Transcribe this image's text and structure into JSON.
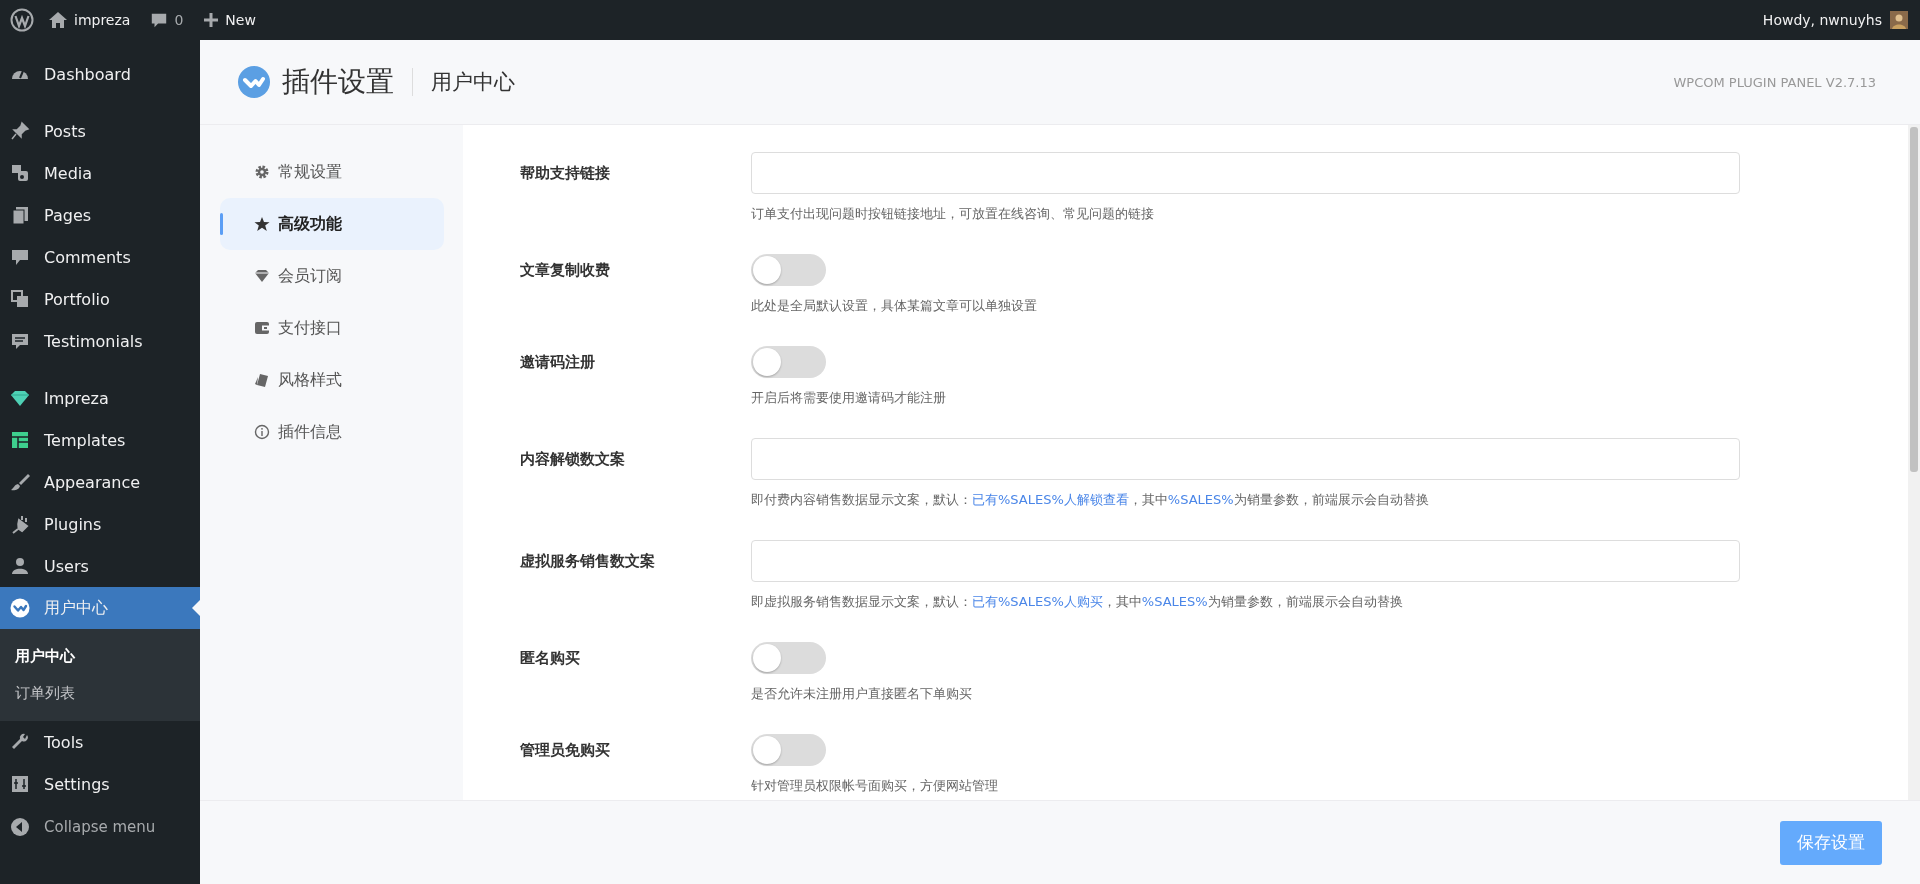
{
  "admin_bar": {
    "site_name": "impreza",
    "comment_count": "0",
    "new_label": "New",
    "greeting": "Howdy, nwnuyhs"
  },
  "admin_menu": {
    "groups": [
      [
        {
          "label": "Dashboard",
          "selected": false
        }
      ],
      [
        {
          "label": "Posts",
          "selected": false
        },
        {
          "label": "Media",
          "selected": false
        },
        {
          "label": "Pages",
          "selected": false
        },
        {
          "label": "Comments",
          "selected": false
        },
        {
          "label": "Portfolio",
          "selected": false
        },
        {
          "label": "Testimonials",
          "selected": false
        }
      ],
      [
        {
          "label": "Impreza",
          "selected": false
        },
        {
          "label": "Templates",
          "selected": false
        },
        {
          "label": "Appearance",
          "selected": false
        },
        {
          "label": "Plugins",
          "selected": false
        },
        {
          "label": "Users",
          "selected": false
        },
        {
          "label": "用户中心",
          "selected": true,
          "children": [
            {
              "label": "用户中心",
              "selected": true
            },
            {
              "label": "订单列表",
              "selected": false
            }
          ]
        },
        {
          "label": "Tools",
          "selected": false
        },
        {
          "label": "Settings",
          "selected": false
        }
      ]
    ],
    "collapse_label": "Collapse menu"
  },
  "panel": {
    "title": "插件设置",
    "subtitle": "用户中心",
    "version": "WPCOM PLUGIN PANEL V2.7.13",
    "nav": [
      {
        "label": "常规设置",
        "selected": false
      },
      {
        "label": "高级功能",
        "selected": true
      },
      {
        "label": "会员订阅",
        "selected": false
      },
      {
        "label": "支付接口",
        "selected": false
      },
      {
        "label": "风格样式",
        "selected": false
      },
      {
        "label": "插件信息",
        "selected": false
      }
    ],
    "fields": [
      {
        "kind": "text",
        "label": "帮助支持链接",
        "description": [
          {
            "text": "订单支付出现问题时按钮链接地址，可放置在线咨询、常见问题的链接",
            "link": false
          }
        ]
      },
      {
        "kind": "toggle",
        "label": "文章复制收费",
        "on": false,
        "description": [
          {
            "text": "此处是全局默认设置，具体某篇文章可以单独设置",
            "link": false
          }
        ]
      },
      {
        "kind": "toggle",
        "label": "邀请码注册",
        "on": false,
        "description": [
          {
            "text": "开启后将需要使用邀请码才能注册",
            "link": false
          }
        ]
      },
      {
        "kind": "text",
        "label": "内容解锁数文案",
        "description": [
          {
            "text": "即付费内容销售数据显示文案，默认：",
            "link": false
          },
          {
            "text": "已有%SALES%人解锁查看",
            "link": true
          },
          {
            "text": "，其中",
            "link": false
          },
          {
            "text": "%SALES%",
            "link": true
          },
          {
            "text": "为销量参数，前端展示会自动替换",
            "link": false
          }
        ]
      },
      {
        "kind": "text",
        "label": "虚拟服务销售数文案",
        "description": [
          {
            "text": "即虚拟服务销售数据显示文案，默认：",
            "link": false
          },
          {
            "text": "已有%SALES%人购买",
            "link": true
          },
          {
            "text": "，其中",
            "link": false
          },
          {
            "text": "%SALES%",
            "link": true
          },
          {
            "text": "为销量参数，前端展示会自动替换",
            "link": false
          }
        ]
      },
      {
        "kind": "toggle",
        "label": "匿名购买",
        "on": false,
        "description": [
          {
            "text": "是否允许未注册用户直接匿名下单购买",
            "link": false
          }
        ]
      },
      {
        "kind": "toggle",
        "label": "管理员免购买",
        "on": false,
        "description": [
          {
            "text": "针对管理员权限帐号面购买，方便网站管理",
            "link": false
          }
        ]
      }
    ],
    "save_button": "保存设置"
  }
}
